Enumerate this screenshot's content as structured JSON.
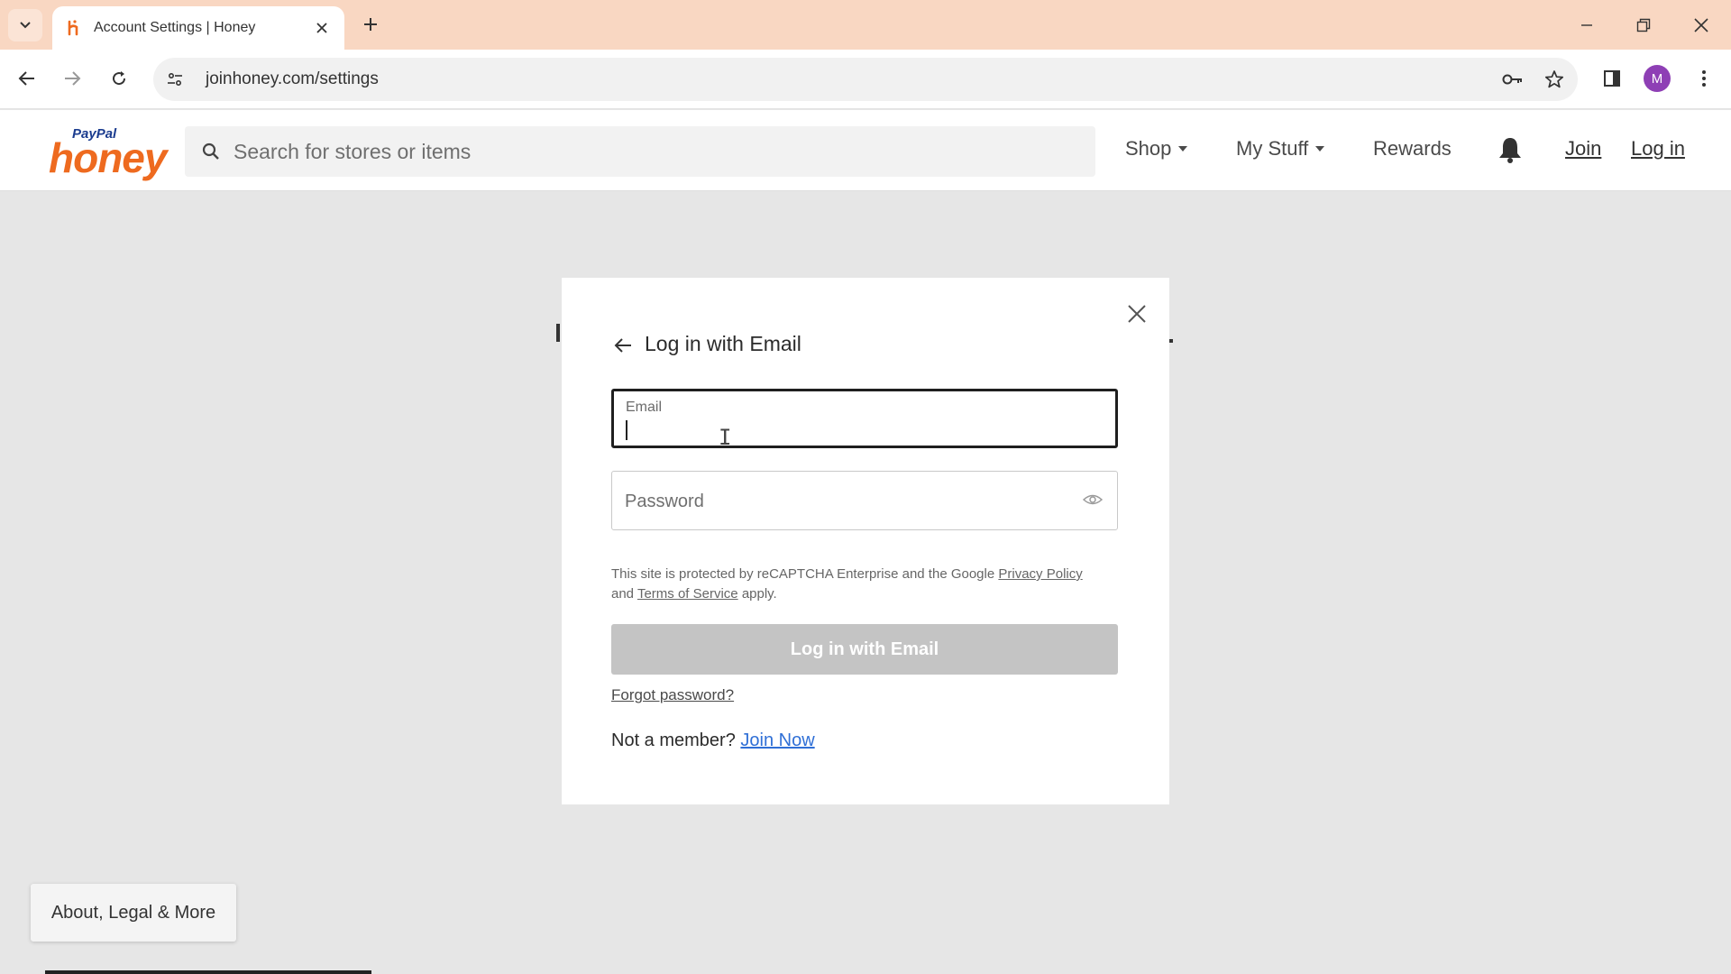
{
  "browser": {
    "tab_title": "Account Settings | Honey",
    "url": "joinhoney.com/settings",
    "profile_initial": "M"
  },
  "header": {
    "logo_paypal": "PayPal",
    "logo_honey": "honey",
    "search_placeholder": "Search for stores or items",
    "nav": {
      "shop": "Shop",
      "my_stuff": "My Stuff",
      "rewards": "Rewards",
      "join": "Join",
      "login": "Log in"
    }
  },
  "modal": {
    "title": "Log in with Email",
    "email_label": "Email",
    "email_value": "",
    "password_placeholder": "Password",
    "recaptcha_text_1": "This site is protected by reCAPTCHA Enterprise and the Google",
    "privacy_link": "Privacy Policy",
    "recaptcha_and": "and",
    "terms_link": "Terms of Service",
    "recaptcha_apply": "apply.",
    "submit_label": "Log in with Email",
    "forgot_label": "Forgot password?",
    "not_member": "Not a member?",
    "join_now": "Join Now"
  },
  "footer": {
    "about_label": "About, Legal & More"
  },
  "colors": {
    "tabbar": "#f9d7c2",
    "honey_orange": "#ee6a1f",
    "paypal_blue": "#1b3c8f",
    "link_blue": "#2f6fd6",
    "disabled_button": "#c4c4c4",
    "profile_purple": "#8e3fb5"
  }
}
